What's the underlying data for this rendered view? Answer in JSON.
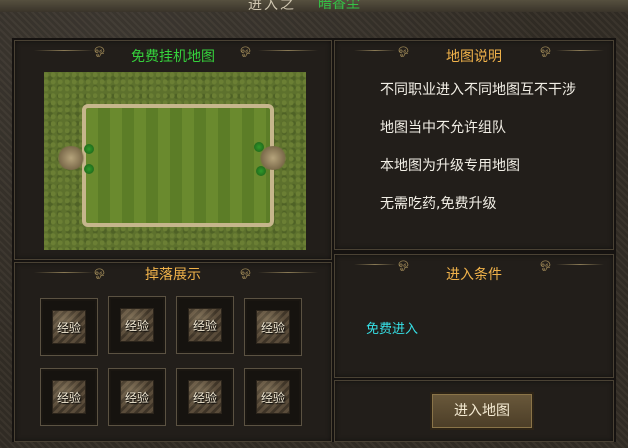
{
  "top_banner": {
    "partial_text": "进入之",
    "partial_text_green": "暗香尘"
  },
  "map_panel": {
    "title": "免费挂机地图"
  },
  "description_panel": {
    "title": "地图说明",
    "lines": [
      "不同职业进入不同地图互不干涉",
      "地图当中不允许组队",
      "本地图为升级专用地图",
      "无需吃药,免费升级"
    ]
  },
  "drops_panel": {
    "title": "掉落展示",
    "items": [
      "经验",
      "经验",
      "经验",
      "经验",
      "经验",
      "经验",
      "经验",
      "经验"
    ]
  },
  "conditions_panel": {
    "title": "进入条件",
    "condition": "免费进入"
  },
  "enter_button": {
    "label": "进入地图"
  },
  "colors": {
    "map_title": "#35d23c",
    "section_title": "#f0b24a",
    "condition_text": "#36e0e6"
  }
}
